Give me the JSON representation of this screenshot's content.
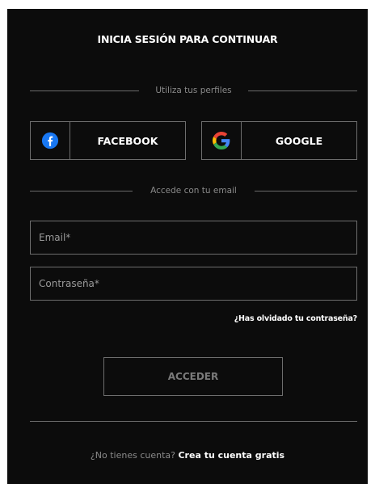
{
  "login": {
    "title": "INICIA SESIÓN PARA CONTINUAR",
    "social_divider": "Utiliza tus perfiles",
    "facebook_label": "FACEBOOK",
    "google_label": "GOOGLE",
    "email_divider": "Accede con tu email",
    "email_placeholder": "Email*",
    "password_placeholder": "Contraseña*",
    "forgot_password": "¿Has olvidado tu contraseña?",
    "submit_label": "ACCEDER",
    "no_account_text": "¿No tienes cuenta?",
    "create_account_link": "Crea tu cuenta gratis"
  },
  "icons": {
    "facebook": "facebook-icon",
    "google": "google-icon"
  },
  "colors": {
    "background": "#0c0c0c",
    "border": "#6e6e6e",
    "text": "#ffffff",
    "muted_text": "#8a8a8a",
    "facebook_blue": "#1877f2",
    "google_blue": "#4285f4",
    "google_red": "#ea4335",
    "google_yellow": "#fbbc05",
    "google_green": "#34a853"
  }
}
